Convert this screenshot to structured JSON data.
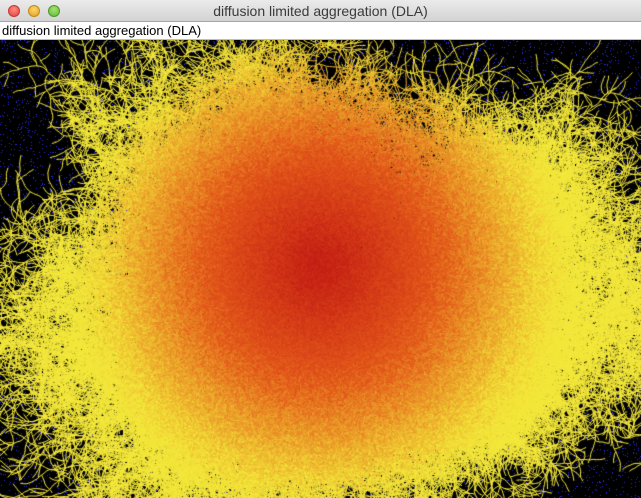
{
  "window": {
    "title": "diffusion limited aggregation (DLA)"
  },
  "canvas": {
    "label": "diffusion limited aggregation (DLA)"
  },
  "colors": {
    "background": "#000000",
    "walkers": "#2a2ad6",
    "cluster_core": "#c41e14",
    "cluster_mid": "#e4581a",
    "cluster_tips": "#f4e83a"
  },
  "icons": {
    "close": "close-icon",
    "minimize": "minimize-icon",
    "zoom": "zoom-icon"
  }
}
